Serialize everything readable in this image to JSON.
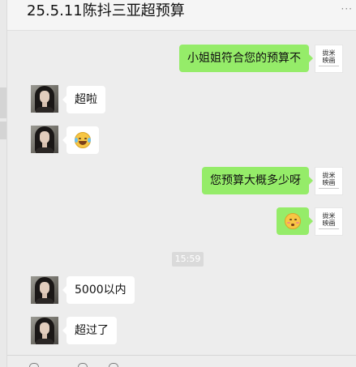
{
  "window": {
    "title": "25.5.11陈抖三亚超预算",
    "more_icon": "more-dots-icon"
  },
  "contacts": {
    "self_logo_lines": [
      "拢米",
      "映画"
    ],
    "self_avatar_icon": "brand-logo-avatar",
    "other_avatar_icon": "user-photo-avatar"
  },
  "messages": [
    {
      "from": "self",
      "text": "小姐姐符合您的预算不"
    },
    {
      "from": "other",
      "text": "超啦"
    },
    {
      "from": "other",
      "emoji": "grinning-sweat-emoji"
    },
    {
      "from": "self",
      "text": "您预算大概多少呀"
    },
    {
      "from": "self",
      "emoji": "embarrassed-emoji"
    },
    {
      "from": "other",
      "text": "5000以内"
    },
    {
      "from": "other",
      "text": "超过了"
    }
  ],
  "timestamp": "15:59",
  "colors": {
    "chat_background": "#ededed",
    "outgoing_bubble": "#95ec69",
    "incoming_bubble": "#ffffff",
    "timestamp_bg": "#dadada"
  }
}
